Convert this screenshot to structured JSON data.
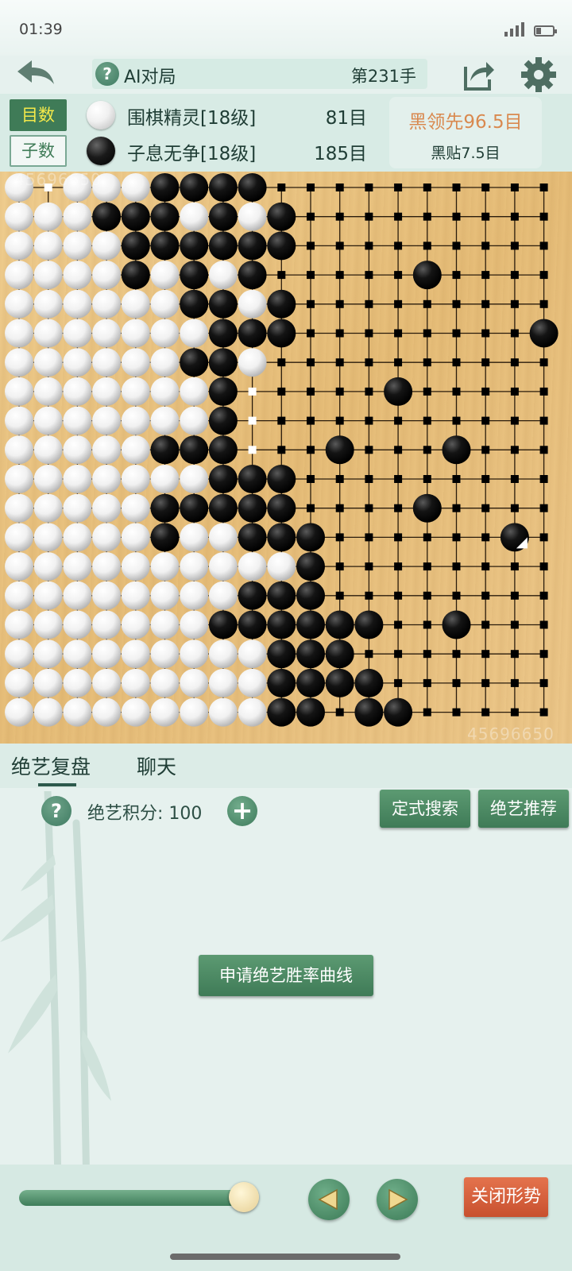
{
  "status_bar": {
    "time": "01:39"
  },
  "header": {
    "title": "AI对局",
    "move_label": "第231手",
    "help_symbol": "?"
  },
  "score_tabs": {
    "active": "目数",
    "inactive": "子数"
  },
  "players": [
    {
      "color": "white",
      "name": "围棋精灵[18级]",
      "score": "81目"
    },
    {
      "color": "black",
      "name": "子息无争[18级]",
      "score": "185目"
    }
  ],
  "lead": {
    "text": "黑领先96.5目",
    "komi": "黑贴7.5目"
  },
  "board": {
    "size": 19,
    "watermark": "45696650",
    "rows": [
      "w.wwwbbbb..........",
      "wwwbbbwbwb.........",
      "wwwwbbbbbb.........",
      "wwwwbwbwb.....b....",
      "wwwwwwbbwb.........",
      "wwwwwwwbbb........b",
      "wwwwwwbbw..........",
      "wwwwwwwb.....b.....",
      "wwwwwwwb...........",
      "wwwwwbbb...b...b...",
      "wwwwwwwbbb.........",
      "wwwwwbbbbb....b....",
      "wwwwwbwwbbb......b.",
      "wwwwwwwwwwb........",
      "wwwwwwwwbbb........",
      "wwwwwwwbbbbbb..b...",
      "wwwwwwwwwbbb.......",
      "wwwwwwwwwbbbb......",
      "wwwwwwwwwbb.bb....."
    ],
    "last_move": {
      "col": 17,
      "row": 12
    }
  },
  "tabs": {
    "review": "绝艺复盘",
    "chat": "聊天"
  },
  "review": {
    "score_label": "绝艺积分: 100",
    "plus_symbol": "+",
    "joseki_search": "定式搜索",
    "ai_recommend": "绝艺推荐",
    "request_curve": "申请绝艺胜率曲线"
  },
  "controls": {
    "close_label": "关闭形势",
    "slider_value": 1.0
  },
  "colors": {
    "accent": "#3f7b57",
    "lead": "#d9894f",
    "close": "#d35f3b"
  }
}
